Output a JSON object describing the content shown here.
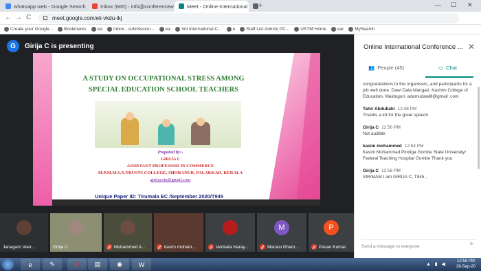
{
  "browser": {
    "tabs": [
      {
        "title": "whatsapp web - Google Search",
        "color": "#4285f4"
      },
      {
        "title": "Inbox (665) - info@conferencew...",
        "color": "#ea4335"
      },
      {
        "title": "Meet - Online International Co...",
        "color": "#00897b",
        "active": true
      },
      {
        "title": "",
        "color": "#5f6368"
      }
    ],
    "new_tab": "+",
    "window_controls": [
      "—",
      "☐",
      "✕"
    ],
    "url": "meet.google.com/eii-vkdu-ikj",
    "nav": {
      "back": "←",
      "forward": "→",
      "reload": "C"
    }
  },
  "bookmarks": [
    "Create your Google...",
    "Bookmarks",
    "ea",
    "Inbox - submission...",
    "ea",
    "3rd International C...",
    "e",
    "Staff List Admin| PC...",
    "USTM:Home",
    "ear",
    "MySearch"
  ],
  "meet": {
    "presenter_initial": "G",
    "presenter_label": "Girija C is presenting",
    "slide": {
      "title_line1": "A STUDY ON OCCUPATIONAL STRESS AMONG",
      "title_line2": "SPECIAL EDUCATION SCHOOL TEACHERS",
      "prepared_label": "Prepared by:-",
      "author": "GIRIJA C",
      "role": "ASSISTANT PROFESSOR IN COMMERCE",
      "college": "M.P.M.M.S.N.TRUSTS COLLEGE, SHORANUR, PALAKKAD, KERALA",
      "email": "girijacotp@gmail.com",
      "paper_id": "Unique Paper ID: Tirumala EC /September 2020/T945"
    },
    "participants": [
      {
        "name": "Janagam Veer..."
      },
      {
        "name": "Girija C"
      },
      {
        "name": "Muhammed A..."
      },
      {
        "name": "kasim moham..."
      },
      {
        "name": "Venkata Naray..."
      },
      {
        "name": "Manasi Gham...",
        "initial": "M",
        "color": "#7e57c2"
      },
      {
        "name": "Pavan Kumar",
        "initial": "P",
        "color": "#f4511e"
      }
    ]
  },
  "panel": {
    "title": "Online International Conference ...",
    "close": "✕",
    "tab_people": "People (45)",
    "tab_chat": "Chat",
    "messages": [
      {
        "who": "",
        "time": "",
        "text": "congratulations to the organisers, and participants for a job well done. Dawi Dala Mangari, Kashim College of Education, Maiduguri. adamudawi8@gmail .com"
      },
      {
        "who": "Tahir Abdullahi",
        "time": "12:48 PM",
        "text": "Thanks a lot for the great speech"
      },
      {
        "who": "Girija C",
        "time": "12:50 PM",
        "text": "Not audible"
      },
      {
        "who": "kasim mohammed",
        "time": "12:54 PM",
        "text": "Kasim Muhammad Pindiga Gombe State University/ Federal Teaching Hospital Gombe Thank you"
      },
      {
        "who": "Girija C",
        "time": "12:56 PM",
        "text": "SIR/MAM I am GIRIJA C, T945 ,"
      }
    ],
    "compose_placeholder": "Send a message to everyone",
    "send": "➤"
  },
  "taskbar": {
    "time": "12:58 PM",
    "date": "26-Sep-20"
  }
}
